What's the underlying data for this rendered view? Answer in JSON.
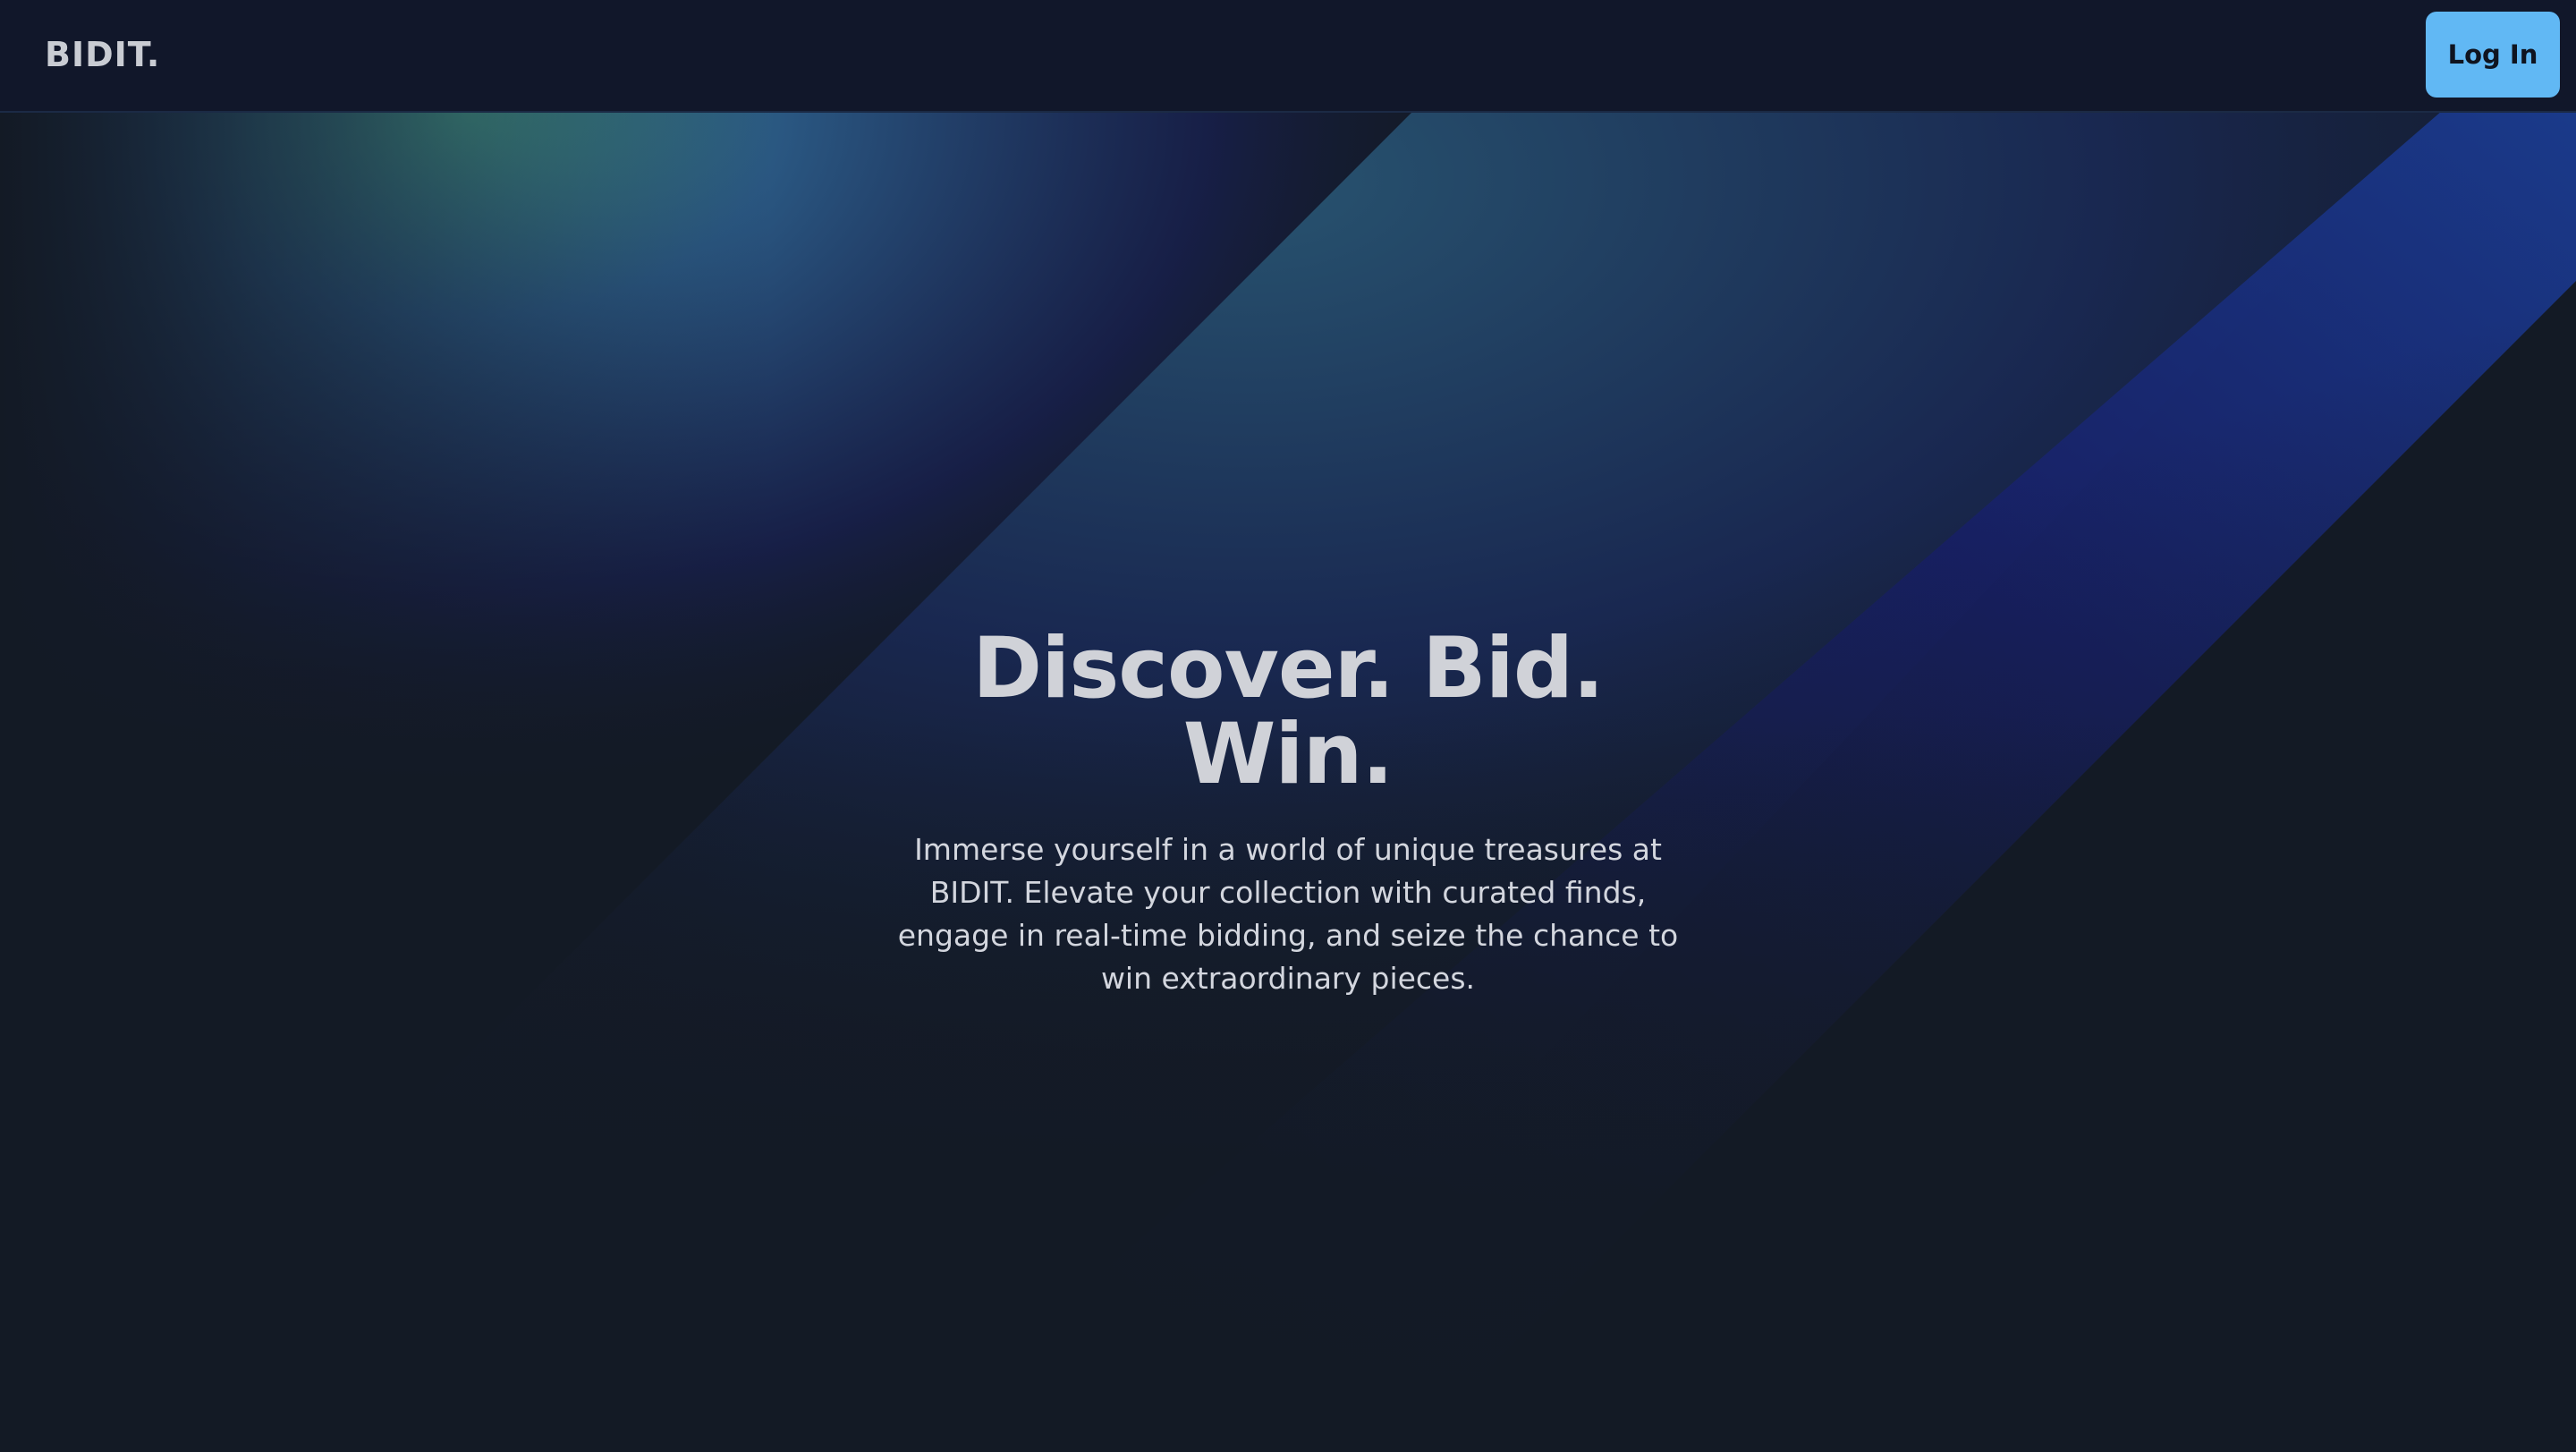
{
  "navbar": {
    "logo": "BIDIT.",
    "login_label": "Log In"
  },
  "hero": {
    "title": "Discover. Bid. Win.",
    "subtitle": "Immerse yourself in a world of unique treasures at BIDIT. Elevate your collection with curated finds, engage in real-time bidding, and seize the chance to win extraordinary pieces."
  },
  "colors": {
    "background": "#131a25",
    "navbar": "#11172a",
    "accent_button": "#61b8f4",
    "heading_text": "#d0d2d8",
    "body_text": "#d3d6de"
  }
}
